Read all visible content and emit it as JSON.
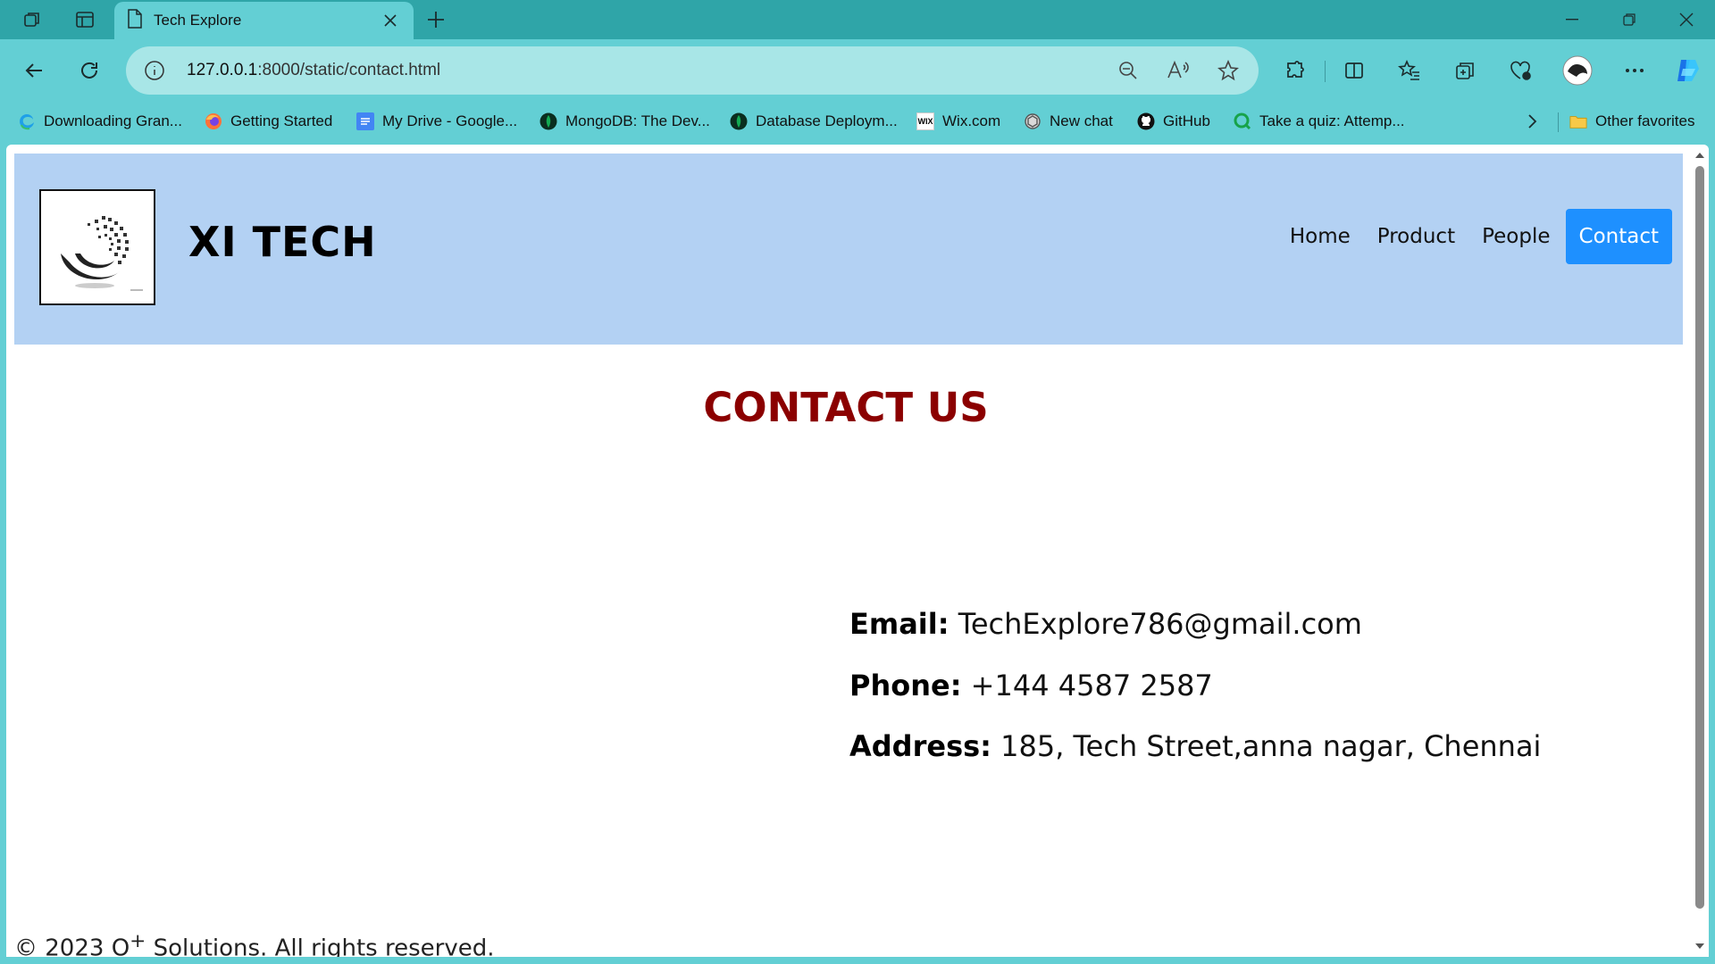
{
  "browser": {
    "tab": {
      "title": "Tech Explore"
    },
    "url": {
      "host": "127.0.0.1",
      "path": ":8000/static/contact.html"
    },
    "bookmarks": [
      {
        "label": "Downloading Gran...",
        "icon": "edge-icon"
      },
      {
        "label": "Getting Started",
        "icon": "firefox-icon"
      },
      {
        "label": "My Drive - Google...",
        "icon": "google-docs-icon"
      },
      {
        "label": "MongoDB: The Dev...",
        "icon": "mongodb-icon"
      },
      {
        "label": "Database Deploym...",
        "icon": "mongodb-icon"
      },
      {
        "label": "Wix.com",
        "icon": "wix-icon"
      },
      {
        "label": "New chat",
        "icon": "openai-icon"
      },
      {
        "label": "GitHub",
        "icon": "github-icon"
      },
      {
        "label": "Take a quiz: Attemp...",
        "icon": "quiz-icon"
      }
    ],
    "other_favorites": "Other favorites"
  },
  "site": {
    "brand": "XI TECH",
    "nav": [
      {
        "label": "Home",
        "active": false
      },
      {
        "label": "Product",
        "active": false
      },
      {
        "label": "People",
        "active": false
      },
      {
        "label": "Contact",
        "active": true
      }
    ],
    "title": "CONTACT US",
    "contact": {
      "email_label": "Email:",
      "email_value": "TechExplore786@gmail.com",
      "phone_label": "Phone:",
      "phone_value": "+144 4587 2587",
      "address_label": "Address:",
      "address_value": "185, Tech Street,anna nagar, Chennai"
    },
    "footer": {
      "prefix": "© 2023 O",
      "sup": "+",
      "suffix": " Solutions. All rights reserved."
    }
  },
  "colors": {
    "chrome": "#63cfd4",
    "tabstrip": "#2fa5a8",
    "header_bg": "#b3d1f3",
    "nav_active": "#1e90ff",
    "title": "#8b0000"
  }
}
